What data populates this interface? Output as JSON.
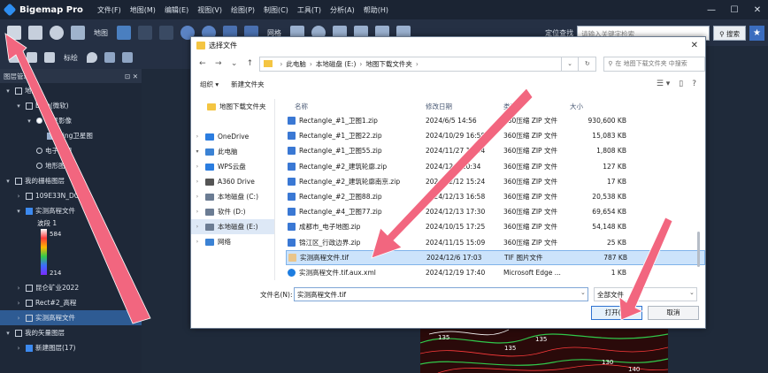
{
  "app": {
    "title": "Bigemap Pro",
    "menu": [
      "文件(F)",
      "地图(M)",
      "编辑(E)",
      "视图(V)",
      "绘图(P)",
      "制图(C)",
      "工具(T)",
      "分析(A)",
      "帮助(H)"
    ],
    "window_controls": [
      "—",
      "☐",
      "✕"
    ]
  },
  "toolbar": {
    "map_label": "地图",
    "grid_label": "网格",
    "locate_label": "定位查找",
    "search_placeholder": "请输入关键字检索",
    "search_button": "搜索",
    "annotate_label": "标绘"
  },
  "left_panel": {
    "header": "图层管理",
    "header_controls": "⊡ ✕",
    "tree": [
      {
        "label": "地图",
        "indent": 0,
        "chev": "▾",
        "box": "cb"
      },
      {
        "label": "Bing(微软)",
        "indent": 1,
        "chev": "▾",
        "box": "cb"
      },
      {
        "label": "卫星影像",
        "indent": 2,
        "chev": "▾",
        "box": "radio-on"
      },
      {
        "label": "bing卫星图",
        "indent": 3,
        "chev": "",
        "box": "layer"
      },
      {
        "label": "电子地图",
        "indent": 2,
        "chev": "",
        "box": "radio"
      },
      {
        "label": "地形图",
        "indent": 2,
        "chev": "",
        "box": "radio"
      },
      {
        "label": "我的栅格图层",
        "indent": 0,
        "chev": "▾",
        "box": "cb"
      },
      {
        "label": "109E33N_DOP30",
        "indent": 1,
        "chev": "›",
        "box": "cb"
      },
      {
        "label": "实测高程文件",
        "indent": 1,
        "chev": "▾",
        "box": "cb-checked"
      }
    ],
    "legend": {
      "band": "波段 1",
      "max": "584",
      "min": "214"
    },
    "tree2": [
      {
        "label": "昆仑矿业2022",
        "indent": 1,
        "chev": "›",
        "box": "cb",
        "selected": false
      },
      {
        "label": "Rect#2_高程",
        "indent": 1,
        "chev": "›",
        "box": "cb",
        "selected": false
      },
      {
        "label": "实测高程文件",
        "indent": 1,
        "chev": "›",
        "box": "cb",
        "selected": true
      },
      {
        "label": "我的矢量图层",
        "indent": 0,
        "chev": "▾",
        "box": "cb",
        "selected": false
      },
      {
        "label": "新建图层(17)",
        "indent": 1,
        "chev": "›",
        "box": "cb-checked",
        "selected": false
      }
    ]
  },
  "map": {
    "contour_labels": [
      "135",
      "135",
      "135",
      "130",
      "140"
    ]
  },
  "dialog": {
    "title": "选择文件",
    "breadcrumb": [
      "此电脑",
      "本地磁盘 (E:)",
      "地图下载文件夹"
    ],
    "search_placeholder": "在 地图下载文件夹 中搜索",
    "organize": "组织 ▾",
    "new_folder": "新建文件夹",
    "nav": [
      {
        "label": "地图下载文件夹",
        "chev": "",
        "color": "#f4c542",
        "selected": false
      },
      {
        "label": "",
        "chev": "",
        "color": "transparent",
        "selected": false
      },
      {
        "label": "OneDrive",
        "chev": "›",
        "color": "#2b7de0",
        "selected": false
      },
      {
        "label": "此电脑",
        "chev": "▾",
        "color": "#3b82d4",
        "selected": false
      },
      {
        "label": "WPS云盘",
        "chev": "›",
        "color": "#2b7de0",
        "selected": false
      },
      {
        "label": "A360 Drive",
        "chev": "›",
        "color": "#555555",
        "selected": false
      },
      {
        "label": "本地磁盘 (C:)",
        "chev": "›",
        "color": "#6b7c93",
        "selected": false
      },
      {
        "label": "软件 (D:)",
        "chev": "›",
        "color": "#6b7c93",
        "selected": false
      },
      {
        "label": "本地磁盘 (E:)",
        "chev": "›",
        "color": "#6b7c93",
        "selected": true
      },
      {
        "label": "网络",
        "chev": "›",
        "color": "#3b82d4",
        "selected": false
      }
    ],
    "columns": [
      "名称",
      "修改日期",
      "类型",
      "大小"
    ],
    "files": [
      {
        "name": "Rectangle_#1_卫图1.zip",
        "date": "2024/6/5 14:56",
        "type": "360压缩 ZIP 文件",
        "size": "930,600 KB",
        "icon": "zip",
        "selected": false
      },
      {
        "name": "Rectangle_#1_卫图22.zip",
        "date": "2024/10/29 16:58",
        "type": "360压缩 ZIP 文件",
        "size": "15,083 KB",
        "icon": "zip",
        "selected": false
      },
      {
        "name": "Rectangle_#1_卫图55.zip",
        "date": "2024/11/27 15:34",
        "type": "360压缩 ZIP 文件",
        "size": "1,808 KB",
        "icon": "zip",
        "selected": false
      },
      {
        "name": "Rectangle_#2_建筑轮廓.zip",
        "date": "2024/12/4 10:34",
        "type": "360压缩 ZIP 文件",
        "size": "127 KB",
        "icon": "zip",
        "selected": false
      },
      {
        "name": "Rectangle_#2_建筑轮廓南京.zip",
        "date": "2024/12/12 15:24",
        "type": "360压缩 ZIP 文件",
        "size": "17 KB",
        "icon": "zip",
        "selected": false
      },
      {
        "name": "Rectangle_#2_卫图88.zip",
        "date": "2024/12/13 16:58",
        "type": "360压缩 ZIP 文件",
        "size": "20,538 KB",
        "icon": "zip",
        "selected": false
      },
      {
        "name": "Rectangle_#4_卫图77.zip",
        "date": "2024/12/13 17:30",
        "type": "360压缩 ZIP 文件",
        "size": "69,654 KB",
        "icon": "zip",
        "selected": false
      },
      {
        "name": "成都市_电子地图.zip",
        "date": "2024/10/15 17:25",
        "type": "360压缩 ZIP 文件",
        "size": "54,148 KB",
        "icon": "zip",
        "selected": false
      },
      {
        "name": "锦江区_行政边界.zip",
        "date": "2024/11/15 15:09",
        "type": "360压缩 ZIP 文件",
        "size": "25 KB",
        "icon": "zip",
        "selected": false
      },
      {
        "name": "实测高程文件.tif",
        "date": "2024/12/6 17:03",
        "type": "TIF 图片文件",
        "size": "787 KB",
        "icon": "tif",
        "selected": true
      },
      {
        "name": "实测高程文件.tif.aux.xml",
        "date": "2024/12/19 17:40",
        "type": "Microsoft Edge ...",
        "size": "1 KB",
        "icon": "xml",
        "selected": false
      }
    ],
    "filename_label": "文件名(N):",
    "filename_value": "实测高程文件.tif",
    "filetype_value": "全部文件",
    "open_button": "打开(O)",
    "cancel_button": "取消"
  },
  "colors": {
    "app_bg": "#1f2a3a",
    "accent": "#2f73d1",
    "arrow": "#f2667f"
  }
}
